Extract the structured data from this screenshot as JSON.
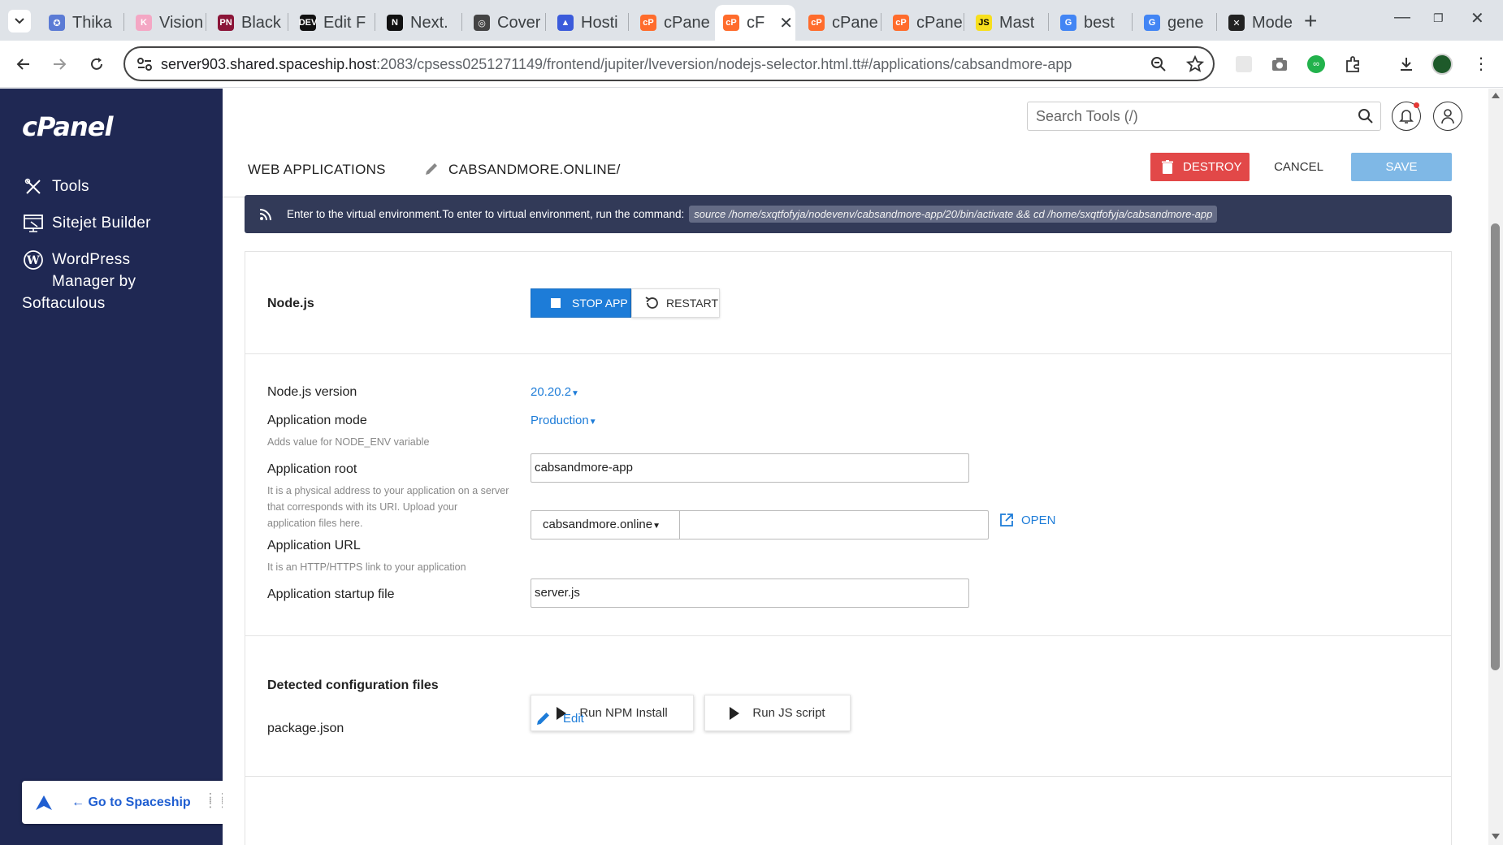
{
  "browser": {
    "tabs": [
      {
        "title": "Thika",
        "favicon_color": "#5b7bd5",
        "favicon_glyph": "✪"
      },
      {
        "title": "Vision",
        "favicon_color": "#f4a7c4",
        "favicon_glyph": "K"
      },
      {
        "title": "Black",
        "favicon_color": "#8b1538",
        "favicon_glyph": "PN"
      },
      {
        "title": "Edit F",
        "favicon_color": "#111111",
        "favicon_glyph": "DEV"
      },
      {
        "title": "Next.",
        "favicon_color": "#111111",
        "favicon_glyph": "N"
      },
      {
        "title": "Cover",
        "favicon_color": "#444444",
        "favicon_glyph": "◎"
      },
      {
        "title": "Hosti",
        "favicon_color": "#3b5bdb",
        "favicon_glyph": "▲"
      },
      {
        "title": "cPane",
        "favicon_color": "#ff6c2c",
        "favicon_glyph": "cP"
      },
      {
        "title": "cF",
        "favicon_color": "#ff6c2c",
        "favicon_glyph": "cP",
        "active": true
      },
      {
        "title": "cPane",
        "favicon_color": "#ff6c2c",
        "favicon_glyph": "cP"
      },
      {
        "title": "cPane",
        "favicon_color": "#ff6c2c",
        "favicon_glyph": "cP"
      },
      {
        "title": "Mast",
        "favicon_color": "#f7df1e",
        "favicon_glyph": "JS"
      },
      {
        "title": "best",
        "favicon_color": "#4285f4",
        "favicon_glyph": "G"
      },
      {
        "title": "gene",
        "favicon_color": "#4285f4",
        "favicon_glyph": "G"
      },
      {
        "title": "Mode",
        "favicon_color": "#222222",
        "favicon_glyph": "✕"
      }
    ],
    "close_glyph": "✕",
    "new_tab_glyph": "+",
    "url_host": "server903.shared.spaceship.host",
    "url_rest": ":2083/cpsess0251271149/frontend/jupiter/lveversion/nodejs-selector.html.tt#/applications/cabsandmore-app"
  },
  "sidebar": {
    "logo": "cPanel",
    "items": [
      {
        "label": "Tools",
        "icon": "tools-icon"
      },
      {
        "label": "Sitejet Builder",
        "icon": "sitejet-icon"
      },
      {
        "label_line1": "WordPress",
        "label_line2": "Manager by",
        "label_line3": "Softaculous",
        "icon": "wordpress-icon"
      }
    ],
    "spaceship_link": "← Go to Spaceship"
  },
  "header": {
    "search_placeholder": "Search Tools (/)"
  },
  "tabs": {
    "web_applications": "WEB APPLICATIONS",
    "current_app": "CABSANDMORE.ONLINE/"
  },
  "actions": {
    "destroy": "DESTROY",
    "cancel": "CANCEL",
    "save": "SAVE"
  },
  "info_bar": {
    "text": "Enter to the virtual environment.To enter to virtual environment, run the command:",
    "command": "source /home/sxqtfofyja/nodevenv/cabsandmore-app/20/bin/activate && cd /home/sxqtfofyja/cabsandmore-app"
  },
  "nodejs_section": {
    "title": "Node.js",
    "stop_app": "STOP APP",
    "restart": "RESTART"
  },
  "form": {
    "version_label": "Node.js version",
    "version_value": "20.20.2",
    "mode_label": "Application mode",
    "mode_value": "Production",
    "mode_hint": "Adds value for NODE_ENV variable",
    "root_label": "Application root",
    "root_value": "cabsandmore-app",
    "root_hint_1": "It is a physical address to your application on a server",
    "root_hint_2": "that corresponds with its URI. Upload your",
    "root_hint_3": "application files here.",
    "url_label": "Application URL",
    "url_domain": "cabsandmore.online",
    "url_path": "",
    "url_hint": "It is an HTTP/HTTPS link to your application",
    "open": "OPEN",
    "startup_label": "Application startup file",
    "startup_value": "server.js"
  },
  "config": {
    "title": "Detected configuration files",
    "run_npm": "Run NPM Install",
    "run_js": "Run JS script",
    "file": "package.json",
    "edit": "Edit"
  },
  "colors": {
    "sidebar_bg": "#1f2853",
    "primary": "#1d7cd8",
    "destroy": "#e24848",
    "save_disabled": "#7fb8e6",
    "info_bar": "#323a58"
  }
}
